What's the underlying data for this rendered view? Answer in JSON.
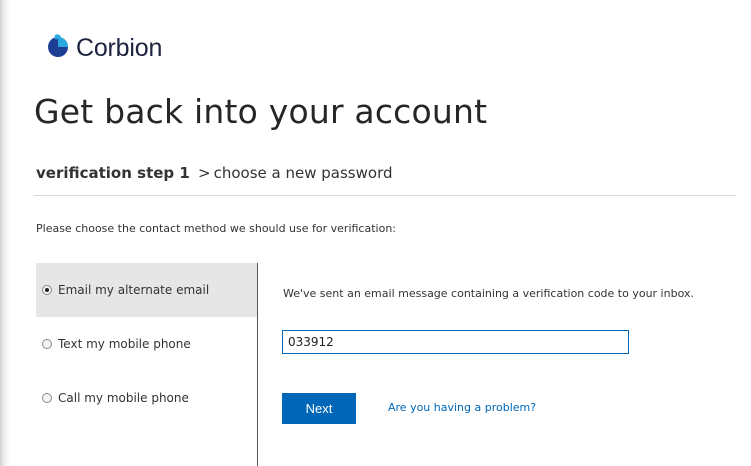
{
  "brand": {
    "name": "Corbion",
    "logo_icon": "corbion-logo-mark",
    "logo_colors": [
      "#1c3f94",
      "#2aa9e0"
    ]
  },
  "page": {
    "title": "Get back into your account"
  },
  "breadcrumb": {
    "current_step": "verification step 1",
    "separator": ">",
    "next_step": "choose a new password"
  },
  "instructions": "Please choose the contact method we should use for verification:",
  "contact_methods": [
    {
      "label": "Email my alternate email",
      "selected": true
    },
    {
      "label": "Text my mobile phone",
      "selected": false
    },
    {
      "label": "Call my mobile phone",
      "selected": false
    }
  ],
  "verification": {
    "message": "We've sent an email message containing a verification code to your inbox.",
    "code_value": "033912",
    "next_label": "Next",
    "problem_link": "Are you having a problem?"
  },
  "colors": {
    "accent": "#0067b8",
    "selected_background": "#e6e6e6"
  }
}
